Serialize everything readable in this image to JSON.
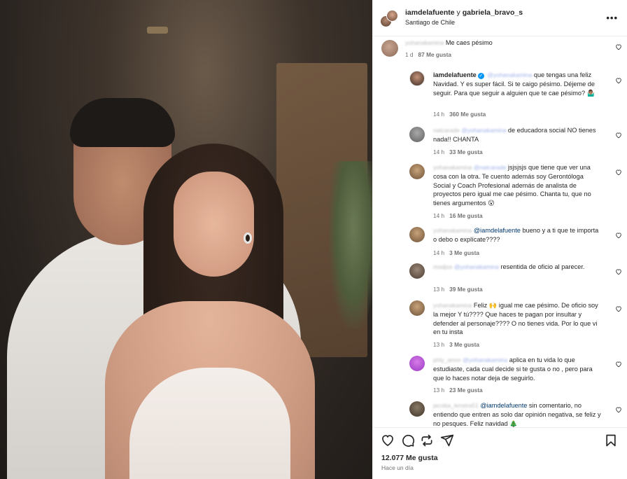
{
  "header": {
    "user1": "iamdelafuente",
    "conj": "y",
    "user2": "gabriela_bravo_s",
    "location": "Santiago de Chile",
    "more": "•••"
  },
  "comments": [
    {
      "user": "yohanakamina",
      "text": "Me caes pésimo",
      "time": "1 d",
      "likes": "87 Me gusta"
    },
    {
      "user": "iamdelafuente",
      "mention": "@yohanakamina",
      "text": "que tengas una feliz Navidad. Y es super fácil. Si te caigo pésimo. Déjeme de seguir. Para que seguir a alguien que te cae pésimo? 🤷🏽‍♂️",
      "time": "14 h",
      "likes": "360 Me gusta"
    },
    {
      "user": "natcarade",
      "mention": "@yohanakamina",
      "text": "de educadora social NO tienes nada!! CHANTA",
      "time": "14 h",
      "likes": "33 Me gusta"
    },
    {
      "user": "yohanakamina",
      "mention": "@natcarade",
      "text": "jsjsjsjs que tiene que ver una cosa con la otra. Te cuento además soy Gerontóloga Social y Coach Profesional además de analista de proyectos pero igual me cae pésimo. Chanta tu, que no tienes argumentos 😮",
      "time": "14 h",
      "likes": "16 Me gusta"
    },
    {
      "user": "yohanakamina",
      "mention": "@iamdelafuente",
      "text": "bueno y a ti que te importa o debo o explícate????",
      "time": "14 h",
      "likes": "3 Me gusta"
    },
    {
      "user": "modjos",
      "mention": "@yohanakamina",
      "text": "resentida de oficio al parecer.",
      "time": "13 h",
      "likes": "39 Me gusta"
    },
    {
      "user": "yohanakamina",
      "text": "Feliz 🙌 igual me cae pésimo. De oficio soy la mejor Y tú???? Que haces te pagan por insultar y defender al personaje???? O no tienes vida. Por lo que vi en tu insta",
      "time": "13 h",
      "likes": "3 Me gusta"
    },
    {
      "user": "phly_amor",
      "mention": "@yohanakamina",
      "text": "aplica en tu vida lo que estudiaste, cada cual decide si te gusta o no , pero para que lo haces notar deja de seguirlo.",
      "time": "13 h",
      "likes": "23 Me gusta"
    },
    {
      "user": "jacoba_lenstra51",
      "mention": "@iamdelafuente",
      "text": "sin comentario, no entiendo que entren as solo dar opinión negativa, se feliz y no pesques. Feliz navidad 🎄",
      "time": "",
      "likes": ""
    }
  ],
  "footer": {
    "likes_total": "12.077 Me gusta",
    "time_ago": "Hace un día"
  },
  "colors": {
    "text": "#262626",
    "muted": "#737373",
    "link": "#00376b",
    "verified": "#0095f6"
  }
}
